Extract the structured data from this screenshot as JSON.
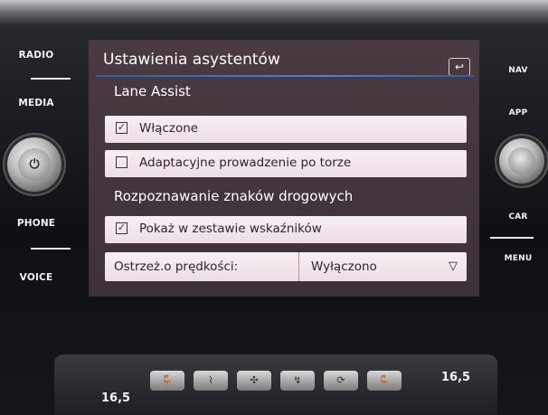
{
  "screen": {
    "title": "Ustawienia asystentów",
    "back_icon": "back-arrow-icon",
    "sections": [
      {
        "heading": "Lane Assist"
      },
      {
        "heading": "Rozpoznawanie znaków drogowych"
      }
    ],
    "lane_assist": {
      "enabled": {
        "label": "Włączone",
        "checked": true
      },
      "adaptive": {
        "label": "Adaptacyjne prowadzenie po torze",
        "checked": false
      }
    },
    "sign_recognition": {
      "show_in_cluster": {
        "label": "Pokaż w zestawie wskaźników",
        "checked": true
      },
      "speed_warning": {
        "label": "Ostrzeż.o prędkości:",
        "value": "Wyłączono"
      }
    }
  },
  "left_buttons": [
    "RADIO",
    "MEDIA",
    "PHONE",
    "VOICE"
  ],
  "right_buttons": [
    "NAV",
    "APP",
    "CAR",
    "MENU"
  ],
  "climate": {
    "left_temp": "16,5",
    "right_temp": "16,5"
  },
  "colors": {
    "row_bg": "#f0e4ec",
    "screen_bg": "#463840",
    "accent_line": "#4a82d4"
  }
}
